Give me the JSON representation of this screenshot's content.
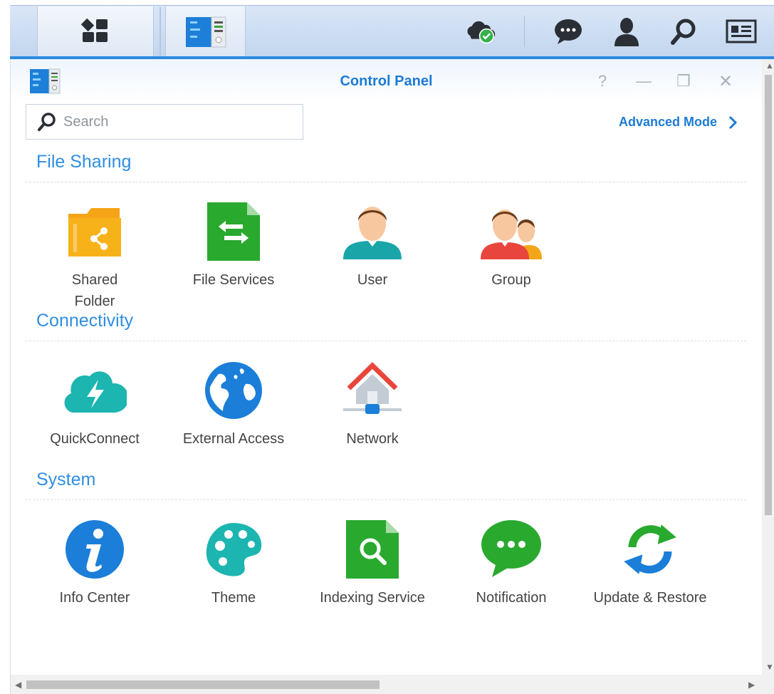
{
  "window": {
    "title": "Control Panel",
    "controls": {
      "help": "?",
      "minimize": "—",
      "restore": "❐",
      "close": "✕"
    }
  },
  "search": {
    "placeholder": "Search",
    "value": ""
  },
  "advanced_mode": {
    "label": "Advanced Mode",
    "chevron": "›"
  },
  "sections": [
    {
      "title": "File Sharing",
      "items": [
        {
          "label": "Shared Folder",
          "icon": "shared-folder-icon"
        },
        {
          "label": "File Services",
          "icon": "file-services-icon"
        },
        {
          "label": "User",
          "icon": "user-icon"
        },
        {
          "label": "Group",
          "icon": "group-icon"
        }
      ]
    },
    {
      "title": "Connectivity",
      "items": [
        {
          "label": "QuickConnect",
          "icon": "quickconnect-icon"
        },
        {
          "label": "External Access",
          "icon": "external-access-icon"
        },
        {
          "label": "Network",
          "icon": "network-icon"
        }
      ]
    },
    {
      "title": "System",
      "items": [
        {
          "label": "Info Center",
          "icon": "info-center-icon"
        },
        {
          "label": "Theme",
          "icon": "theme-icon"
        },
        {
          "label": "Indexing Service",
          "icon": "indexing-service-icon"
        },
        {
          "label": "Notification",
          "icon": "notification-icon"
        },
        {
          "label": "Update & Restore",
          "icon": "update-restore-icon"
        }
      ]
    }
  ],
  "taskbar": {
    "tray": [
      "cloud-sync-icon",
      "chat-icon",
      "user-account-icon",
      "search-icon",
      "widgets-icon"
    ]
  },
  "colors": {
    "accent": "#1c7bd6",
    "section_title": "#2f8ee3",
    "taskbar_border": "#2b8ae0"
  }
}
